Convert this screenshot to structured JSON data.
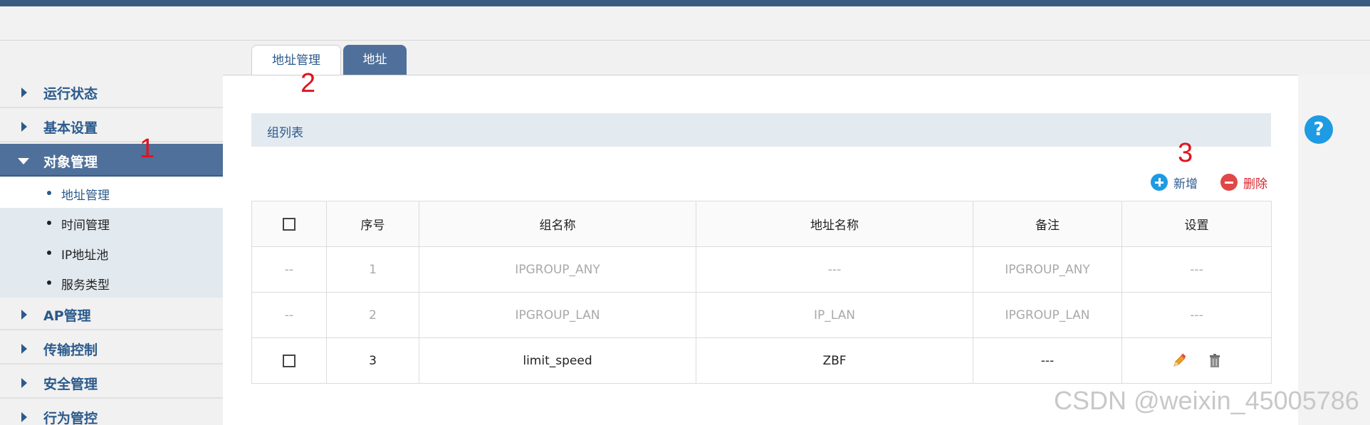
{
  "tabs": [
    {
      "label": "地址管理",
      "active": true
    },
    {
      "label": "地址",
      "active": false
    }
  ],
  "sidebar": {
    "items": [
      {
        "label": "运行状态",
        "expanded": false
      },
      {
        "label": "基本设置",
        "expanded": false
      },
      {
        "label": "对象管理",
        "expanded": true
      },
      {
        "label": "AP管理",
        "expanded": false
      },
      {
        "label": "传输控制",
        "expanded": false
      },
      {
        "label": "安全管理",
        "expanded": false
      },
      {
        "label": "行为管控",
        "expanded": false
      }
    ],
    "subitems": [
      {
        "label": "地址管理",
        "selected": true
      },
      {
        "label": "时间管理",
        "selected": false
      },
      {
        "label": "IP地址池",
        "selected": false
      },
      {
        "label": "服务类型",
        "selected": false
      }
    ]
  },
  "annotations": [
    "1",
    "2",
    "3"
  ],
  "section": {
    "title": "组列表"
  },
  "actions": {
    "add_label": "新增",
    "delete_label": "删除"
  },
  "table": {
    "columns": [
      "序号",
      "组名称",
      "地址名称",
      "备注",
      "设置"
    ],
    "rows": [
      {
        "select": "--",
        "index": "1",
        "group": "IPGROUP_ANY",
        "address": "---",
        "note": "IPGROUP_ANY",
        "settings": "---"
      },
      {
        "select": "--",
        "index": "2",
        "group": "IPGROUP_LAN",
        "address": "IP_LAN",
        "note": "IPGROUP_LAN",
        "settings": "---"
      },
      {
        "select": "",
        "index": "3",
        "group": "limit_speed",
        "address": "ZBF",
        "note": "---",
        "settings": ""
      }
    ]
  },
  "help_icon": "?",
  "watermark": "CSDN @weixin_45005786",
  "colors": {
    "brand": "#4f709a",
    "accent": "#1e9be2",
    "danger": "#e04848",
    "nav_text": "#2b5a8c"
  }
}
